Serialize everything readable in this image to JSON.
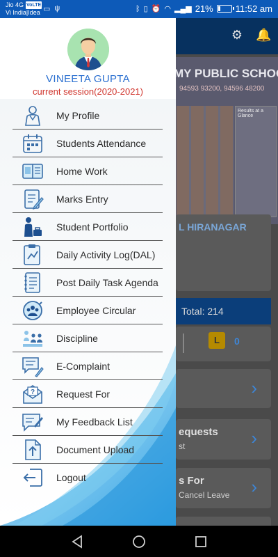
{
  "status_bar": {
    "carrier1": "Jio 4G",
    "volte": "VoLTE",
    "carrier2": "Vi India|Idea",
    "battery": "21%",
    "battery_level": 0.21,
    "time": "11:52 am"
  },
  "drawer": {
    "user_name": "VINEETA GUPTA",
    "session": "current session(2020-2021)",
    "menu": [
      {
        "label": "My Profile",
        "icon": "profile-icon"
      },
      {
        "label": "Students Attendance",
        "icon": "calendar-icon"
      },
      {
        "label": "Home Work",
        "icon": "book-icon"
      },
      {
        "label": "Marks Entry",
        "icon": "marks-entry-icon"
      },
      {
        "label": "Student Portfolio",
        "icon": "student-portfolio-icon"
      },
      {
        "label": "Daily Activity Log(DAL)",
        "icon": "activity-log-icon"
      },
      {
        "label": "Post Daily Task Agenda",
        "icon": "notebook-icon"
      },
      {
        "label": "Employee Circular",
        "icon": "circular-icon"
      },
      {
        "label": "Discipline",
        "icon": "discipline-icon"
      },
      {
        "label": "E-Complaint",
        "icon": "complaint-icon"
      },
      {
        "label": "Request For",
        "icon": "request-icon"
      },
      {
        "label": "My Feedback List",
        "icon": "feedback-icon"
      },
      {
        "label": "Document Upload",
        "icon": "upload-icon"
      },
      {
        "label": "Logout",
        "icon": "logout-icon"
      }
    ]
  },
  "background": {
    "school_name": "MY PUBLIC SCHOOL",
    "school_sub": "94593 93200, 94596 48200",
    "results_title": "Results at a Glance",
    "branch": "L HIRANAGAR",
    "total_label": "Total:",
    "total_value": "214",
    "leave_badge": "L",
    "leave_count": "0",
    "card_requests": "equests",
    "card_requests_sub": "st",
    "card_for": "s For",
    "card_cancel": "Cancel Leave"
  },
  "colors": {
    "status_bar": "#0d5ab8",
    "name": "#2a6fd0",
    "session": "#d0342c",
    "swoosh": "#4fb8ec"
  }
}
